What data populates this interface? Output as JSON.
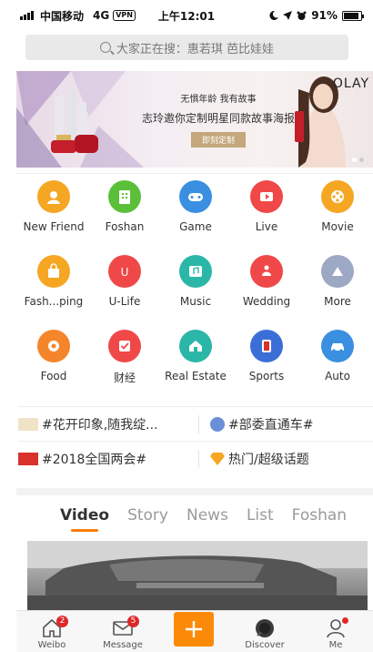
{
  "status_bar": {
    "carrier": "中国移动",
    "network": "4G",
    "vpn": "VPN",
    "time": "上午12:01",
    "battery_percent": "91%",
    "battery_level": 0.91,
    "icons": [
      "signal-icon",
      "moon-icon",
      "location-arrow-icon",
      "alarm-icon",
      "battery-icon"
    ]
  },
  "search": {
    "placeholder": "大家正在搜：惠若琪 芭比娃娃"
  },
  "banner": {
    "line1": "无惧年龄 我有故事",
    "line2": "志玲邀你定制明星同款故事海报",
    "button": "即刻定制",
    "brand": "OLAY",
    "colors": {
      "button": "#c4a77a"
    }
  },
  "grid": [
    {
      "label": "New Friend",
      "icon": "person-icon",
      "color": "#f5a623"
    },
    {
      "label": "Foshan",
      "icon": "building-icon",
      "color": "#5cbf3a"
    },
    {
      "label": "Game",
      "icon": "gamepad-icon",
      "color": "#3b8fe0"
    },
    {
      "label": "Live",
      "icon": "video-camera-icon",
      "color": "#f04848"
    },
    {
      "label": "Movie",
      "icon": "film-reel-icon",
      "color": "#f5a623"
    },
    {
      "label": "Fash...ping",
      "icon": "shopping-bag-icon",
      "color": "#f5a623"
    },
    {
      "label": "U-Life",
      "icon": "u-life-icon",
      "color": "#f04848"
    },
    {
      "label": "Music",
      "icon": "music-icon",
      "color": "#2bb7a8"
    },
    {
      "label": "Wedding",
      "icon": "wedding-icon",
      "color": "#f04848"
    },
    {
      "label": "More",
      "icon": "triangle-up-icon",
      "color": "#9da8c4"
    },
    {
      "label": "Food",
      "icon": "flower-icon",
      "color": "#f5852a"
    },
    {
      "label": "财经",
      "icon": "check-icon",
      "color": "#f04848"
    },
    {
      "label": "Real Estate",
      "icon": "house-icon",
      "color": "#2bb7a8"
    },
    {
      "label": "Sports",
      "icon": "nba-icon",
      "color": "#3b6fd8"
    },
    {
      "label": "Auto",
      "icon": "car-icon",
      "color": "#3b8fe0"
    }
  ],
  "topics": [
    {
      "text": "#花开印象,随我绽...",
      "thumb_color": "#efe3c8"
    },
    {
      "text": "#部委直通车#",
      "thumb_color": "#6b8fd6"
    },
    {
      "text": "#2018全国两会#",
      "thumb_color": "#d8322b"
    },
    {
      "text": "热门/超级话题",
      "thumb_color": "#f5a623"
    }
  ],
  "tabs": [
    "Video",
    "Story",
    "News",
    "List",
    "Foshan"
  ],
  "active_tab": "Video",
  "tabbar": [
    {
      "label": "Weibo",
      "icon": "home-icon",
      "badge": "2"
    },
    {
      "label": "Message",
      "icon": "envelope-icon",
      "badge": "5"
    },
    {
      "label": "",
      "icon": "plus-icon",
      "badge": ""
    },
    {
      "label": "Discover",
      "icon": "discover-icon",
      "badge": ""
    },
    {
      "label": "Me",
      "icon": "person-outline-icon",
      "badge": ""
    }
  ],
  "colors": {
    "accent": "#fb8a08",
    "badge": "#e02828"
  }
}
